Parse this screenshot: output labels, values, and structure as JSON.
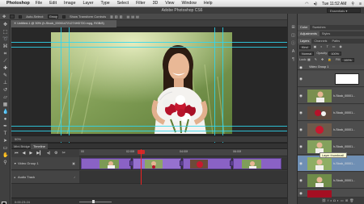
{
  "menubar": {
    "app_name": "Photoshop",
    "items": [
      "File",
      "Edit",
      "Image",
      "Layer",
      "Type",
      "Select",
      "Filter",
      "3D",
      "View",
      "Window",
      "Help"
    ],
    "clock": "Tue 11:52 AM"
  },
  "window": {
    "title": "Adobe Photoshop CS6",
    "workspace": "Essentials"
  },
  "options": {
    "auto_select": "Auto-Select:",
    "auto_select_value": "Group",
    "show_transform": "Show Transform Controls"
  },
  "document": {
    "tab_title": "Untitled-1 @ 50% (h-Stock_000014721274HD720.mpg, RGB/8)",
    "status": "50%"
  },
  "timeline": {
    "tabs": [
      "Mini Bridge",
      "Timeline"
    ],
    "ruler_ticks": [
      "00",
      "02:00f",
      "04:00f",
      "06:00f"
    ],
    "tracks": [
      {
        "label": "Video Group 1"
      },
      {
        "label": "Audio Track"
      }
    ],
    "footer_time": "0:00:23:24"
  },
  "panels": {
    "top_tabs": [
      "Color",
      "Swatches"
    ],
    "mid_tabs": [
      "Adjustments",
      "Styles"
    ],
    "layer_tabs": [
      "Layers",
      "Channels",
      "Paths"
    ],
    "kind_label": "Kind",
    "blend_mode": "Normal",
    "opacity_label": "Opacity:",
    "opacity_value": "100%",
    "lock_label": "Lock:",
    "fill_label": "Fill:",
    "fill_value": "100%",
    "group_name": "Video Group 1",
    "layers": [
      {
        "name": "h-Stock_00001..."
      },
      {
        "name": "h-Stock_00001..."
      },
      {
        "name": "h-Stock_00001..."
      },
      {
        "name": "h-Stock_00001..."
      },
      {
        "name": "h-Stock_00001..."
      },
      {
        "name": "h-Stock_00001..."
      }
    ],
    "tooltip": "Layer thumbnail"
  },
  "colors": {
    "guide": "#2fd7f0",
    "clip": "#8a62c5",
    "playhead": "#e22222",
    "selected_layer": "#6f8fb4"
  }
}
